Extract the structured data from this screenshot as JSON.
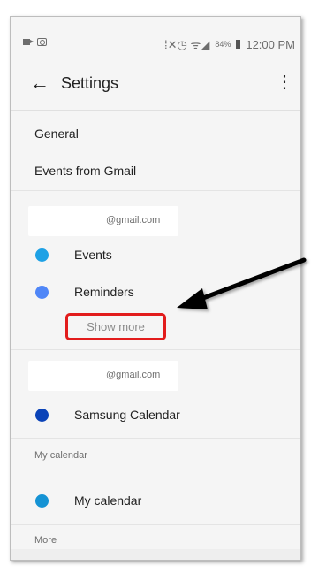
{
  "status_bar": {
    "left_icons": [
      "video-icon",
      "camera-icon"
    ],
    "signal_glyphs": "⁞✕◷ ᯤ◢",
    "battery_percent": "84%",
    "time": "12:00 PM"
  },
  "app_bar": {
    "back_glyph": "←",
    "title": "Settings",
    "overflow_glyph": "⋮"
  },
  "settings": {
    "general": "General",
    "events_from_gmail": "Events from Gmail"
  },
  "account1": {
    "email_suffix": "@gmail.com",
    "calendars": [
      {
        "label": "Events",
        "color": "#1ea1e5"
      },
      {
        "label": "Reminders",
        "color": "#4f86f7"
      }
    ],
    "show_more": "Show more"
  },
  "account2": {
    "email_suffix": "@gmail.com",
    "calendars": [
      {
        "label": "Samsung Calendar",
        "color": "#0b43b8"
      }
    ]
  },
  "my_calendar_section": {
    "header": "My calendar",
    "calendars": [
      {
        "label": "My calendar",
        "color": "#1593d4"
      }
    ]
  },
  "more_section": {
    "header": "More"
  },
  "colors": {
    "highlight_box": "#e21c1c",
    "arrow": "#000000"
  }
}
